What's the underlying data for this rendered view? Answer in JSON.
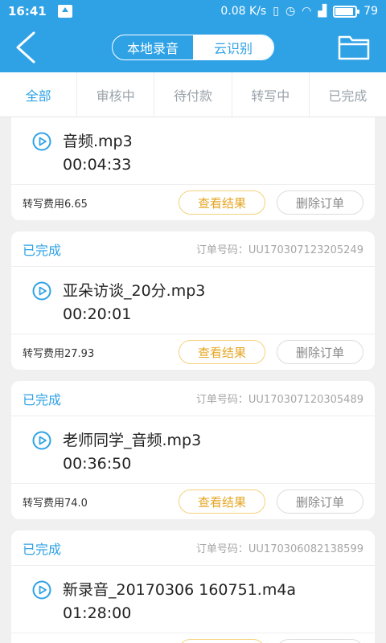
{
  "statusbar": {
    "time": "16:41",
    "speed": "0.08 K/s",
    "battery": "79"
  },
  "header": {
    "segments": [
      "本地录音",
      "云识别"
    ],
    "active_segment": 1
  },
  "tabs": [
    "全部",
    "审核中",
    "待付款",
    "转写中",
    "已完成"
  ],
  "labels": {
    "view_result": "查看结果",
    "delete_order": "删除订单"
  },
  "orders": [
    {
      "status": "",
      "order_no": "",
      "filename": "音频.mp3",
      "duration": "00:04:33",
      "fee": "转写费用6.65"
    },
    {
      "status": "已完成",
      "order_no": "订单号码：UU170307123205249",
      "filename": "亚朵访谈_20分.mp3",
      "duration": "00:20:01",
      "fee": "转写费用27.93"
    },
    {
      "status": "已完成",
      "order_no": "订单号码：UU170307120305489",
      "filename": "老师同学_音频.mp3",
      "duration": "00:36:50",
      "fee": "转写费用74.0"
    },
    {
      "status": "已完成",
      "order_no": "订单号码：UU170306082138599",
      "filename": "新录音_20170306 160751.m4a",
      "duration": "01:28:00",
      "fee": ""
    }
  ],
  "colors": {
    "accent": "#2fa2e6",
    "result_button": "#e6a623"
  }
}
